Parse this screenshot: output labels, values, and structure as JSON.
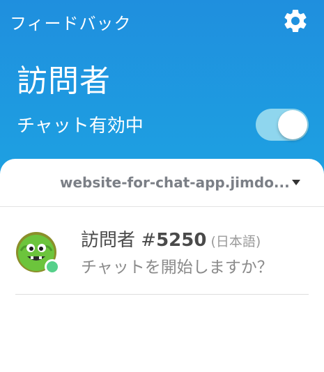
{
  "header": {
    "feedback_label": "フィードバック",
    "title": "訪問者",
    "chat_label": "チャット有効中",
    "chat_enabled": true,
    "gear_icon": "gear-icon"
  },
  "site_select": {
    "value": "website-for-chat-app.jimdo..."
  },
  "visitors": [
    {
      "name_prefix": "訪問者 #",
      "number": "5250",
      "language": "(日本語)",
      "message": "チャットを開始しますか？",
      "status": "online"
    }
  ],
  "colors": {
    "header_bg": "#1f8fde",
    "toggle_track": "#8fd6ee",
    "online": "#56d08a"
  }
}
